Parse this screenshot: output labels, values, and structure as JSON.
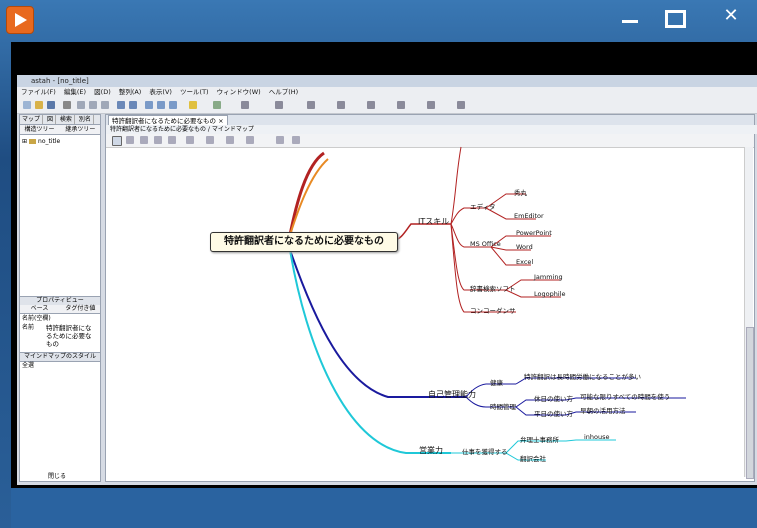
{
  "window": {
    "app_title": "astah - [no_title]",
    "close_glyph": "✕"
  },
  "menu": [
    "ファイル(F)",
    "編集(E)",
    "図(D)",
    "整列(A)",
    "表示(V)",
    "ツール(T)",
    "ウィンドウ(W)",
    "ヘルプ(H)"
  ],
  "left_pane": {
    "tabs": [
      "マップ",
      "図",
      "検索",
      "別名"
    ],
    "sub_tabs": [
      "構造ツリー",
      "継承ツリー"
    ],
    "tree_item": "no_title",
    "prop_header": "プロパティビュー",
    "prop_tabs": [
      "ベース",
      "タグ付き値"
    ],
    "prop_rows": [
      {
        "key": "名前(空欄)",
        "value": ""
      },
      {
        "key": "名前",
        "value": "特許翻訳者になるために必要なもの"
      }
    ],
    "mindmap_style_header": "マインドマップのスタイル",
    "style_row": "全選",
    "close_label": "閉じる"
  },
  "document": {
    "tab_label": "特許翻訳者になるために必要なもの",
    "subtitle": "特許翻訳者になるために必要なもの / マインドマップ"
  },
  "mindmap": {
    "root": "特許翻訳者になるために必要なもの",
    "branches": [
      {
        "label": "ITスキル",
        "color": "#b22222"
      },
      {
        "label": "自己管理能力",
        "color": "#1a1a9e"
      },
      {
        "label": "営業力",
        "color": "#1fc8d8"
      }
    ],
    "it_nodes": {
      "editor": "エディタ",
      "editor_children": [
        "秀丸",
        "EmEditor"
      ],
      "ms_office": "MS Office",
      "office_children": [
        "PowerPoint",
        "Word",
        "Excel"
      ],
      "dict": "辞書検索ソフト",
      "dict_children": [
        "Jamming",
        "Logophile"
      ],
      "concordancer": "コンコーダンサ"
    },
    "self_nodes": {
      "health": "健康",
      "health_child": "特許翻訳は長時間労働になることが多い",
      "time": "時間管理",
      "holiday": "休日の使い方",
      "holiday_child": "可能な限りすべての時間を使う",
      "weekday": "平日の使い方",
      "weekday_child": "早朝の活用方法"
    },
    "sales_nodes": {
      "direct": "仕事を獲得する",
      "office": "弁理士事務所",
      "office_child": "inhouse",
      "agency": "翻訳会社"
    }
  }
}
